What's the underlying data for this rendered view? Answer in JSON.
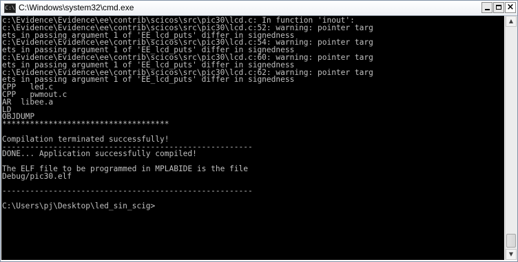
{
  "window": {
    "title": "C:\\Windows\\system32\\cmd.exe",
    "icon": "cmd-icon",
    "icon_text": "C:\\"
  },
  "controls": {
    "minimize": "minimize-icon",
    "maximize": "maximize-icon",
    "close_label": "×"
  },
  "scrollbar": {
    "up_arrow": "▲",
    "down_arrow": "▼",
    "position": 1.0
  },
  "console": {
    "lines": [
      "c:\\Evidence\\Evidence\\ee\\contrib\\scicos\\src\\pic30\\lcd.c: In function 'inout':",
      "c:\\Evidence\\Evidence\\ee\\contrib\\scicos\\src\\pic30\\lcd.c:52: warning: pointer targ",
      "ets in passing argument 1 of 'EE_lcd_puts' differ in signedness",
      "c:\\Evidence\\Evidence\\ee\\contrib\\scicos\\src\\pic30\\lcd.c:54: warning: pointer targ",
      "ets in passing argument 1 of 'EE_lcd_puts' differ in signedness",
      "c:\\Evidence\\Evidence\\ee\\contrib\\scicos\\src\\pic30\\lcd.c:60: warning: pointer targ",
      "ets in passing argument 1 of 'EE_lcd_puts' differ in signedness",
      "c:\\Evidence\\Evidence\\ee\\contrib\\scicos\\src\\pic30\\lcd.c:62: warning: pointer targ",
      "ets in passing argument 1 of 'EE_lcd_puts' differ in signedness",
      "CPP   led.c",
      "CPP   pwmout.c",
      "AR  libee.a",
      "LD",
      "OBJDUMP",
      "************************************",
      "",
      "Compilation terminated successfully!",
      "------------------------------------------------------",
      "DONE... Application successfully compiled!",
      "",
      "The ELF file to be programmed in MPLABIDE is the file",
      "Debug/pic30.elf",
      "",
      "------------------------------------------------------",
      "",
      "C:\\Users\\pj\\Desktop\\led_sin_scig>"
    ]
  }
}
